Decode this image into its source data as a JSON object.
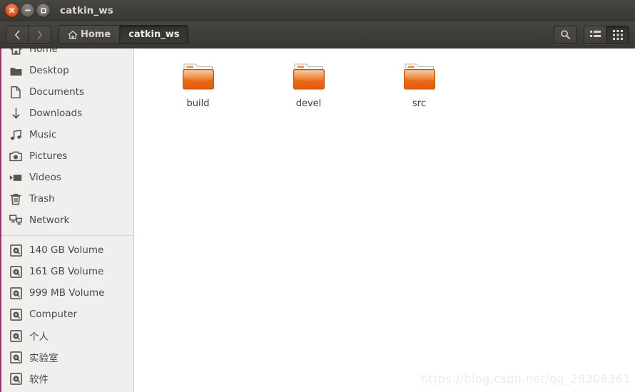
{
  "window": {
    "title": "catkin_ws",
    "controls": [
      {
        "name": "close",
        "glyph": "x"
      },
      {
        "name": "minimize",
        "glyph": "minus"
      },
      {
        "name": "maximize",
        "glyph": "square"
      }
    ]
  },
  "toolbar": {
    "back_label": "‹",
    "forward_label": "›",
    "search_icon": "search-icon",
    "list_view_icon": "list-view-icon",
    "grid_view_icon": "grid-view-icon",
    "active_view": "grid",
    "breadcrumbs": [
      {
        "label": "Home",
        "icon": "home-icon",
        "active": false
      },
      {
        "label": "catkin_ws",
        "icon": null,
        "active": true
      }
    ]
  },
  "sidebar": {
    "items": [
      {
        "label": "Home",
        "icon": "home-icon"
      },
      {
        "label": "Desktop",
        "icon": "folder-icon"
      },
      {
        "label": "Documents",
        "icon": "document-icon"
      },
      {
        "label": "Downloads",
        "icon": "download-icon"
      },
      {
        "label": "Music",
        "icon": "music-icon"
      },
      {
        "label": "Pictures",
        "icon": "camera-icon"
      },
      {
        "label": "Videos",
        "icon": "video-icon"
      },
      {
        "label": "Trash",
        "icon": "trash-icon"
      },
      {
        "label": "Network",
        "icon": "network-icon"
      }
    ],
    "devices": [
      {
        "label": "140 GB Volume",
        "icon": "drive-icon"
      },
      {
        "label": "161 GB Volume",
        "icon": "drive-icon"
      },
      {
        "label": "999 MB Volume",
        "icon": "drive-icon"
      },
      {
        "label": "Computer",
        "icon": "drive-icon"
      },
      {
        "label": "个人",
        "icon": "drive-icon"
      },
      {
        "label": "实验室",
        "icon": "drive-icon"
      },
      {
        "label": "软件",
        "icon": "drive-icon"
      }
    ]
  },
  "content": {
    "files": [
      {
        "name": "build",
        "type": "folder"
      },
      {
        "name": "devel",
        "type": "folder"
      },
      {
        "name": "src",
        "type": "folder"
      }
    ]
  },
  "watermark": "https://blog.csdn.net/qq_28306361",
  "colors": {
    "titlebar": "#403e39",
    "toolbar": "#403e39",
    "sidebar_bg": "#f0efed",
    "content_bg": "#ffffff",
    "folder_orange": "#e8620c",
    "close_button": "#e2592a",
    "window_border_accent": "#8e3e6d",
    "sidebar_text": "#4a4844"
  }
}
